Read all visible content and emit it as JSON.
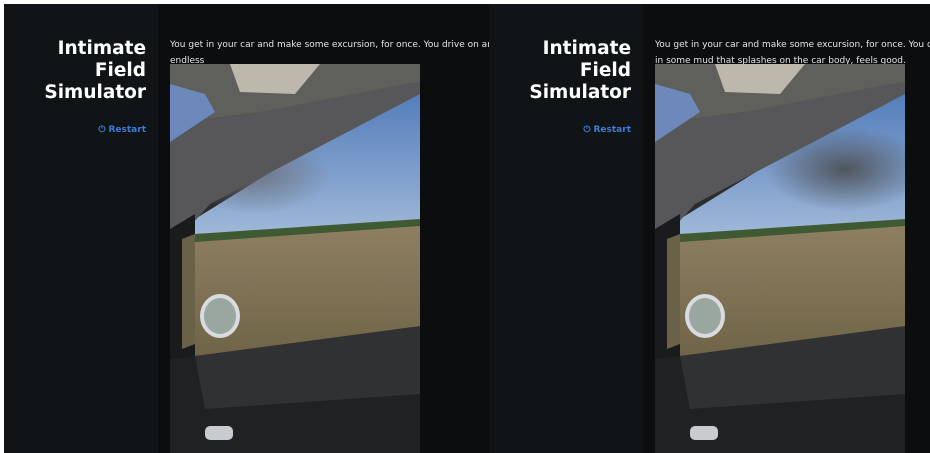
{
  "app": {
    "title_lines": [
      "Intimate",
      "Field",
      "Simulator"
    ],
    "restart_label": "Restart",
    "restart_icon": "power-icon"
  },
  "story": {
    "left_text": "You get in your car and make some excursion, for once. You drive on an endless\nin some mud that splashes on the car body, feels good.",
    "right_text": "You get in your car and make some excursion, for once. You drive on an\nin some mud that splashes on the car body, feels good."
  },
  "colors": {
    "sidebar_bg": "#111416",
    "content_bg": "#0b0d0f",
    "title": "#ffffff",
    "accent_link": "#3d7bd9",
    "body_text": "#e4e6e8"
  }
}
